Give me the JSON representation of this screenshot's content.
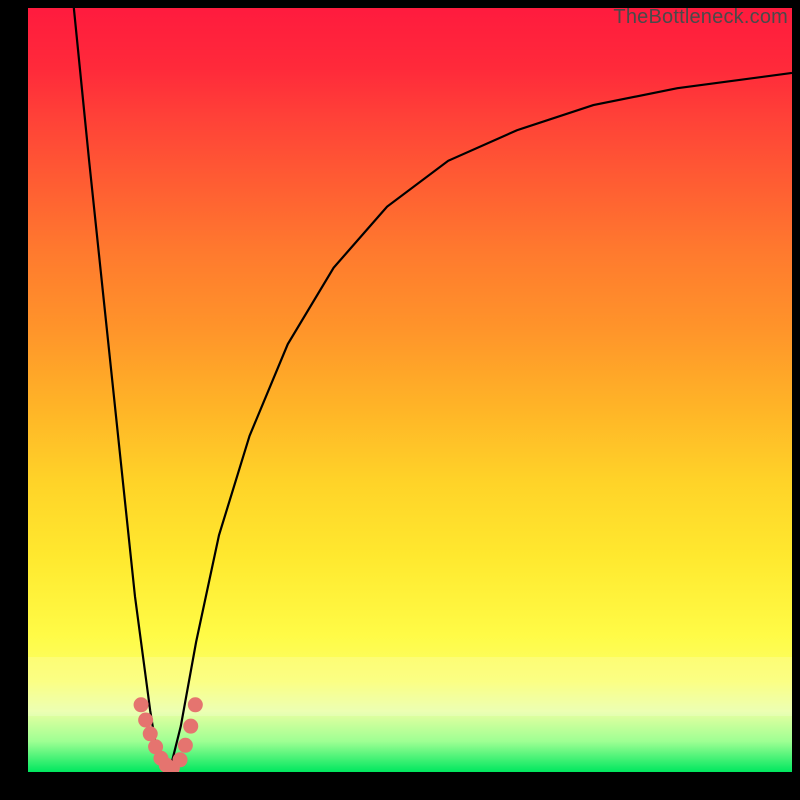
{
  "watermark": "TheBottleneck.com",
  "chart_data": {
    "type": "line",
    "title": "",
    "xlabel": "",
    "ylabel": "",
    "xlim": [
      0,
      1
    ],
    "ylim": [
      0,
      1
    ],
    "grid": false,
    "series": [
      {
        "name": "left-branch",
        "x": [
          0.06,
          0.08,
          0.1,
          0.12,
          0.14,
          0.16,
          0.168,
          0.175,
          0.185
        ],
        "y": [
          1.0,
          0.8,
          0.61,
          0.42,
          0.23,
          0.08,
          0.03,
          0.01,
          0.0
        ]
      },
      {
        "name": "right-branch",
        "x": [
          0.185,
          0.2,
          0.22,
          0.25,
          0.29,
          0.34,
          0.4,
          0.47,
          0.55,
          0.64,
          0.74,
          0.85,
          1.0
        ],
        "y": [
          0.0,
          0.06,
          0.17,
          0.31,
          0.44,
          0.56,
          0.66,
          0.74,
          0.8,
          0.84,
          0.873,
          0.895,
          0.915
        ]
      }
    ],
    "markers": {
      "name": "bottom-dots",
      "color": "#e5746f",
      "points": [
        {
          "x": 0.148,
          "y": 0.088
        },
        {
          "x": 0.154,
          "y": 0.068
        },
        {
          "x": 0.16,
          "y": 0.05
        },
        {
          "x": 0.167,
          "y": 0.033
        },
        {
          "x": 0.174,
          "y": 0.018
        },
        {
          "x": 0.181,
          "y": 0.009
        },
        {
          "x": 0.189,
          "y": 0.005
        },
        {
          "x": 0.199,
          "y": 0.016
        },
        {
          "x": 0.206,
          "y": 0.035
        },
        {
          "x": 0.213,
          "y": 0.06
        },
        {
          "x": 0.219,
          "y": 0.088
        }
      ]
    },
    "highlight_band_y": [
      0.073,
      0.15
    ]
  }
}
